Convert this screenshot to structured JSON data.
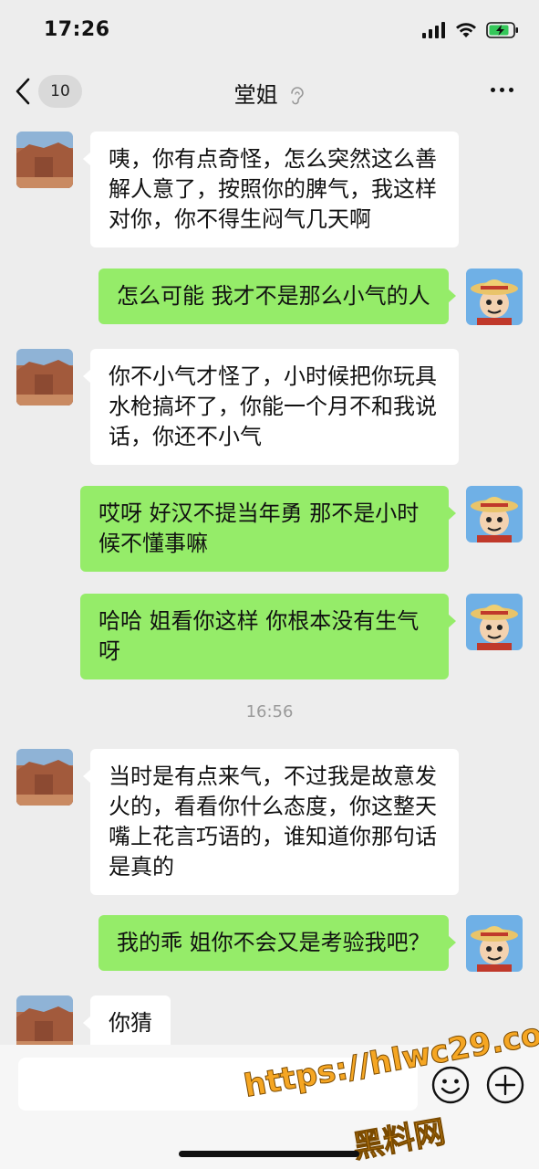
{
  "status_bar": {
    "time": "17:26"
  },
  "nav": {
    "unread_count": "10",
    "title": "堂姐"
  },
  "messages": [
    {
      "side": "in",
      "text": "咦，你有点奇怪，怎么突然这么善解人意了，按照你的脾气，我这样对你，你不得生闷气几天啊"
    },
    {
      "side": "out",
      "text": "怎么可能 我才不是那么小气的人"
    },
    {
      "side": "in",
      "text": "你不小气才怪了，小时候把你玩具水枪搞坏了，你能一个月不和我说话，你还不小气"
    },
    {
      "side": "out",
      "text": "哎呀 好汉不提当年勇 那不是小时候不懂事嘛"
    },
    {
      "side": "out",
      "text": "哈哈 姐看你这样 你根本没有生气呀"
    },
    {
      "side": "in",
      "text": "当时是有点来气，不过我是故意发火的，看看你什么态度，你这整天嘴上花言巧语的，谁知道你那句话是真的"
    },
    {
      "side": "out",
      "text": "我的乖 姐你不会又是考验我吧？"
    },
    {
      "side": "in",
      "text": "你猜"
    }
  ],
  "timestamp": "16:56",
  "watermark": {
    "url": "https://hlwc29.com",
    "name": "黑料网"
  },
  "colors": {
    "background": "#ededed",
    "outgoing_bubble": "#95ec69",
    "incoming_bubble": "#ffffff",
    "watermark": "#f5a623"
  }
}
